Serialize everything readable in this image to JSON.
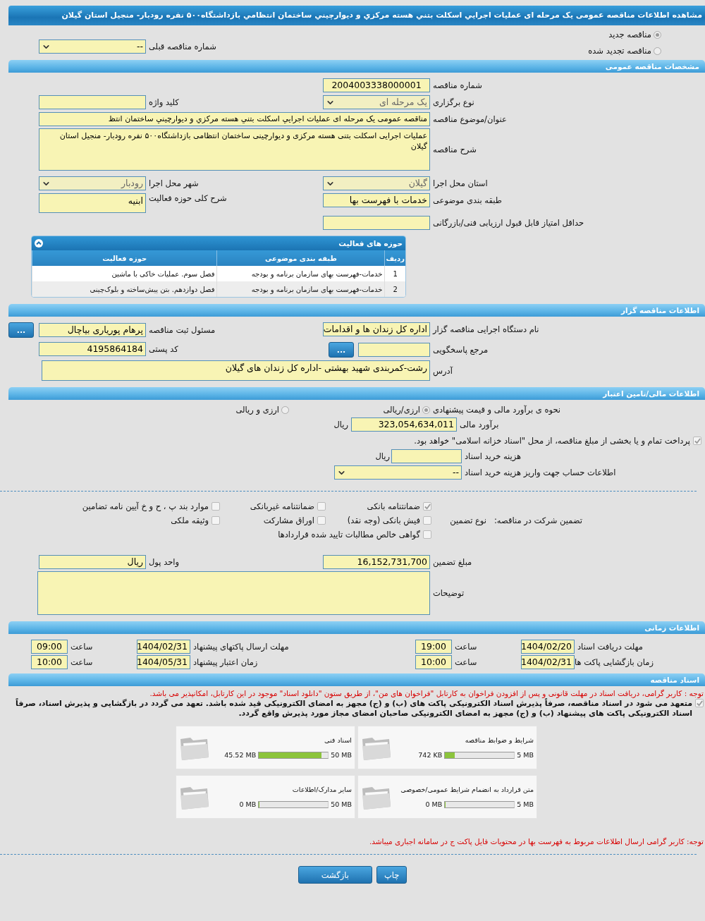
{
  "title": "مشاهده اطلاعات مناقصه عمومی یک مرحله ای عملیات اجرايي اسکلت بتني هسته مرکزي و ديوارچيني ساختمان انتظامي بازداشتگاه۵۰۰ نفره رودبار- منجیل استان گیلان",
  "tender_kind": [
    {
      "label": "مناقصه جدید",
      "selected": true
    },
    {
      "label": "مناقصه تجدید شده",
      "selected": false
    }
  ],
  "previous_tender": {
    "label": "شماره مناقصه قبلی",
    "value": "--"
  },
  "general": {
    "heading": "مشخصات مناقصه عمومی",
    "tender_number": {
      "label": "شماره مناقصه",
      "value": "2004003338000001"
    },
    "holding_type": {
      "label": "نوع برگزاری",
      "value": "یک مرحله ای"
    },
    "keyword": {
      "label": "کلید واژه"
    },
    "subject": {
      "label": "عنوان/موضوع مناقصه",
      "value": "مناقصه عمومی یک مرحله ای عملیات اجرايي اسکلت بتني هسته مرکزي و ديوارچيني ساختمان انتظ"
    },
    "description": {
      "label": "شرح مناقصه",
      "value": "عملیات اجرایی اسکلت بتنی هسته مرکزی و دیوارچینی ساختمان انتظامی بازداشتگاه۵۰۰ نفره رودبار- منجیل استان گیلان"
    },
    "province": {
      "label": "استان محل اجرا",
      "value": "گیلان"
    },
    "city": {
      "label": "شهر محل اجرا",
      "value": "رودبار"
    },
    "category": {
      "label": "طبقه بندی موضوعی",
      "value": "خدمات با فهرست بها"
    },
    "scope": {
      "label": "شرح کلی حوزه فعالیت",
      "value": "ابنیه"
    },
    "min_score": {
      "label": "حداقل امتیاز قابل قبول ارزیابی فنی/بازرگانی"
    },
    "activities": {
      "title": "حوزه های فعالیت",
      "columns": [
        "ردیف",
        "طبقه بندی موضوعی",
        "حوزه فعالیت"
      ],
      "rows": [
        [
          "1",
          "خدمات-فهرست بهای سازمان برنامه و بودجه",
          "فصل سوم. عملیات خاکی با ماشین"
        ],
        [
          "2",
          "خدمات-فهرست بهای سازمان برنامه و بودجه",
          "فصل دوازدهم. بتن پیش‌ساخته و بلوک‌چینی"
        ]
      ]
    }
  },
  "organizer": {
    "heading": "اطلاعات مناقصه گزار",
    "org_name": {
      "label": "نام دستگاه اجرایی مناقصه گزار",
      "value": "اداره کل زندان ها و اقدامات"
    },
    "registrar": {
      "label": "مسئول ثبت مناقصه",
      "value": "پرهام پوریاری بیاچال",
      "button": "..."
    },
    "reference": {
      "label": "مرجع پاسخگویی",
      "button": "..."
    },
    "postal_code": {
      "label": "کد پستی",
      "value": "4195864184"
    },
    "address": {
      "label": "آدرس",
      "value": "رشت-کمربندی شهید بهشتی -اداره کل زندان های گیلان"
    }
  },
  "finance": {
    "heading": "اطلاعات مالی/تامین اعتبار",
    "estimate_method": {
      "label": "نحوه ی برآورد مالی و قیمت پیشنهادی",
      "options": [
        {
          "label": "ارزی/ریالی",
          "selected": true
        },
        {
          "label": "ارزی و ریالی",
          "selected": false
        }
      ]
    },
    "estimate": {
      "label": "برآورد مالی",
      "value": "323,054,634,011",
      "unit": "ریال"
    },
    "treasury": {
      "label": "پرداخت تمام و یا بخشی از مبلغ مناقصه، از محل \"اسناد خزانه اسلامی\" خواهد بود.",
      "checked": true
    },
    "doc_fee": {
      "label": "هزینه خرید اسناد",
      "unit": "ریال"
    },
    "account": {
      "label": "اطلاعات حساب جهت واریز هزینه خرید اسناد",
      "value": "--"
    }
  },
  "guarantee": {
    "label": "تضمین شرکت در مناقصه:",
    "type_label": "نوع تضمین",
    "options": [
      {
        "label": "ضمانتنامه بانکی",
        "checked": true
      },
      {
        "label": "ضمانتنامه غیربانکی",
        "checked": false
      },
      {
        "label": "موارد بند پ ، ح و خ آیین نامه تضامین",
        "checked": false
      },
      {
        "label": "فیش بانکی (وجه نقد)",
        "checked": false
      },
      {
        "label": "اوراق مشارکت",
        "checked": false
      },
      {
        "label": "وثیقه ملکی",
        "checked": false
      },
      {
        "label": "گواهی خالص مطالبات تایید شده قراردادها",
        "checked": false
      }
    ],
    "amount": {
      "label": "مبلغ تضمین",
      "value": "16,152,731,700"
    },
    "currency": {
      "label": "واحد پول",
      "value": "ریال"
    },
    "notes": {
      "label": "توضیحات"
    }
  },
  "timing": {
    "heading": "اطلاعات زمانی",
    "items": [
      {
        "label": "مهلت دریافت اسناد",
        "date": "1404/02/20",
        "time_label": "ساعت",
        "time": "19:00"
      },
      {
        "label": "مهلت ارسال پاکتهای پیشنهاد",
        "date": "1404/02/31",
        "time_label": "ساعت",
        "time": "09:00"
      },
      {
        "label": "زمان بازگشایی پاکت ها",
        "date": "1404/02/31",
        "time_label": "ساعت",
        "time": "10:00"
      },
      {
        "label": "زمان اعتبار پیشنهاد",
        "date": "1404/05/31",
        "time_label": "ساعت",
        "time": "10:00"
      }
    ]
  },
  "documents": {
    "heading": "اسناد مناقصه",
    "notice": "توجه : کاربر گرامی، دریافت اسناد در مهلت قانونی و پس از افزودن فراخوان به کارتابل \"فراخوان های من\"، از طریق ستون \"دانلود اسناد\" موجود در این کارتابل، امکانپذیر می باشد.",
    "commitment": {
      "text": "متعهد می شود در اسناد مناقصه، صرفاً پذیرش اسناد الکترونیکی پاکت های (ب) و (ج) مجهز به امضای الکترونیکی قید شده باشد. تعهد می گردد در بازگشایی و پذیرش اسناد، صرفاً اسناد الکترونیکی پاکت های پیشنهاد (ب) و (ج) مجهز به امضای الکترونیکی صاحبان امضای مجاز مورد پذیرش واقع گردد.",
      "checked": true
    },
    "files": [
      {
        "title": "شرایط و ضوابط مناقصه",
        "used": "742 KB",
        "max": "5 MB",
        "level": 0.145
      },
      {
        "title": "اسناد فنی",
        "used": "45.52 MB",
        "max": "50 MB",
        "level": 0.91
      },
      {
        "title": "متن قرارداد به انضمام شرایط عمومی/خصوصی",
        "used": "0 MB",
        "max": "5 MB",
        "level": 0
      },
      {
        "title": "سایر مدارک/اطلاعات",
        "used": "0 MB",
        "max": "50 MB",
        "level": 0
      }
    ],
    "footer_notice": "توجه: کاربر گرامی ارسال اطلاعات مربوط به فهرست بها در محتویات فایل پاکت ج در سامانه اجباری میباشد."
  },
  "buttons": [
    {
      "label": "چاپ"
    },
    {
      "label": "بازگشت"
    }
  ]
}
